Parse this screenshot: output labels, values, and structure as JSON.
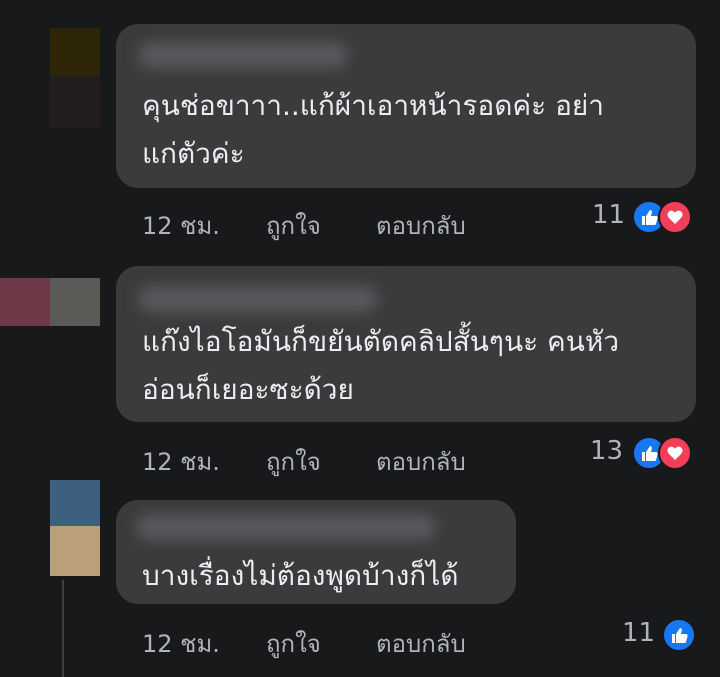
{
  "comments": [
    {
      "text": "คุนช่อขาาา..แก้ผ้าเอาหน้ารอดค่ะ อย่า\nแก่ตัวค่ะ",
      "time": "12 ชม.",
      "like_label": "ถูกใจ",
      "reply_label": "ตอบกลับ",
      "reaction_count": "11",
      "reactions": [
        "like-icon",
        "love-icon"
      ]
    },
    {
      "text": "แก๊งไอโอมันก็ขยันตัดคลิปสั้นๆนะ คนหัว\nอ่อนก็เยอะซะด้วย",
      "time": "12 ชม.",
      "like_label": "ถูกใจ",
      "reply_label": "ตอบกลับ",
      "reaction_count": "13",
      "reactions": [
        "like-icon",
        "love-icon"
      ]
    },
    {
      "text": "บางเรื่องไม่ต้องพูดบ้างก็ได้",
      "time": "12 ชม.",
      "like_label": "ถูกใจ",
      "reply_label": "ตอบกลับ",
      "reaction_count": "11",
      "reactions": [
        "like-icon"
      ]
    }
  ],
  "colors": {
    "background": "#18191a",
    "bubble": "#3a3b3c",
    "like": "#1877f2",
    "love": "#f33e58",
    "meta_text": "#b0b3b8"
  }
}
